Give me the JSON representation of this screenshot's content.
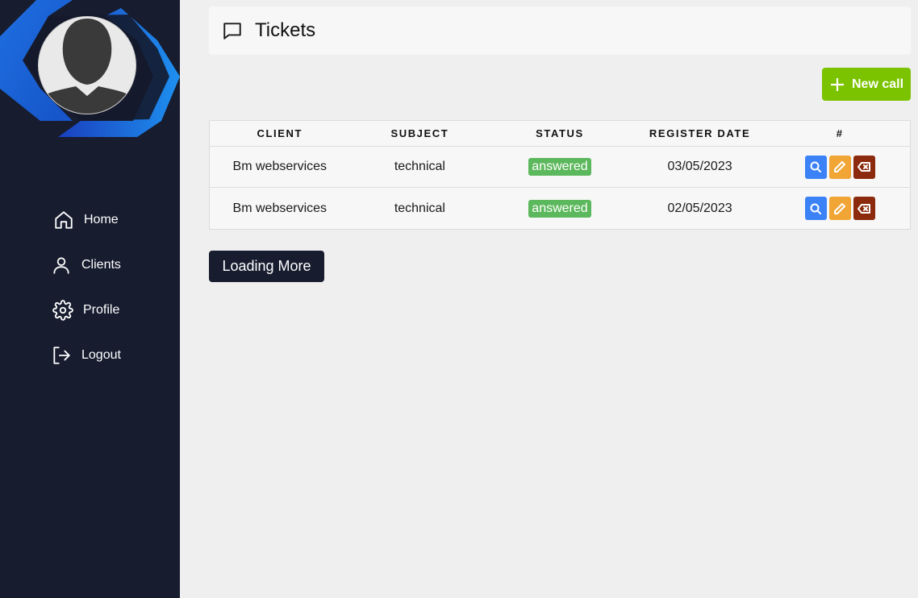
{
  "sidebar": {
    "nav": [
      {
        "label": "Home",
        "icon": "home-icon"
      },
      {
        "label": "Clients",
        "icon": "user-icon"
      },
      {
        "label": "Profile",
        "icon": "gear-icon"
      },
      {
        "label": "Logout",
        "icon": "logout-icon"
      }
    ]
  },
  "header": {
    "title": "Tickets",
    "icon": "message-square-icon"
  },
  "toolbar": {
    "new_call_label": "New call"
  },
  "table": {
    "columns": [
      "CLIENT",
      "SUBJECT",
      "STATUS",
      "REGISTER DATE",
      "#"
    ],
    "rows": [
      {
        "client": "Bm webservices",
        "subject": "technical",
        "status": "answered",
        "date": "03/05/2023"
      },
      {
        "client": "Bm webservices",
        "subject": "technical",
        "status": "answered",
        "date": "02/05/2023"
      }
    ]
  },
  "load_more_label": "Loading More",
  "colors": {
    "sidebar_bg": "#171c2f",
    "accent_green": "#7bc300",
    "status_answered": "#5cb85c",
    "view_button": "#3b82f6",
    "edit_button": "#f0a534",
    "delete_button": "#8b2a0c"
  }
}
